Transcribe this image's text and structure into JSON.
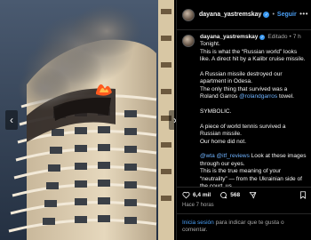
{
  "post": {
    "header": {
      "username": "dayana_yastremskay",
      "separator": "•",
      "follow_label": "Seguir",
      "more_label": "•••"
    },
    "caption": {
      "username": "dayana_yastremskay",
      "edited_label": "Editado",
      "time_short": "7 h",
      "lines": [
        "Tonight.",
        "This is what the “Russian world” looks like. A direct hit by a Kalibr cruise missile."
      ],
      "p2": "A Russian missile destroyed our apartment in Odesa.",
      "p3_before": "The only thing that survived was a Roland Garros ",
      "p3_mention": "@rolandgarros",
      "p3_after": " towel.",
      "p4": "SYMBOLIC.",
      "p5a": "A piece of world tennis survived a Russian missile.",
      "p5b": "Our home did not.",
      "p6_mention1": "@wta",
      "p6_mention2": "@itf_reviews",
      "p6_text": " Look at these images through our eyes.",
      "p6b": "This is the true meaning of your “neutrality” — from the Ukrainian side of the court. us"
    },
    "stats": {
      "likes": "6,4 mil",
      "comments": "568"
    },
    "time_ago": "Hace 7 horas",
    "login": {
      "link_text": "Inicia sesión",
      "rest_text": " para indicar que te gusta o comentar."
    }
  },
  "icons": {
    "verified": "verified-badge-icon",
    "like": "heart-icon",
    "comment": "comment-icon",
    "share": "send-icon",
    "save": "bookmark-icon",
    "prev": "chevron-left-icon",
    "next": "chevron-right-icon"
  },
  "colors": {
    "background": "#000000",
    "accent_link": "#4a9ff5",
    "mention": "#6fb3ff",
    "verified": "#3897f0",
    "fire": "#ff5a1f"
  }
}
